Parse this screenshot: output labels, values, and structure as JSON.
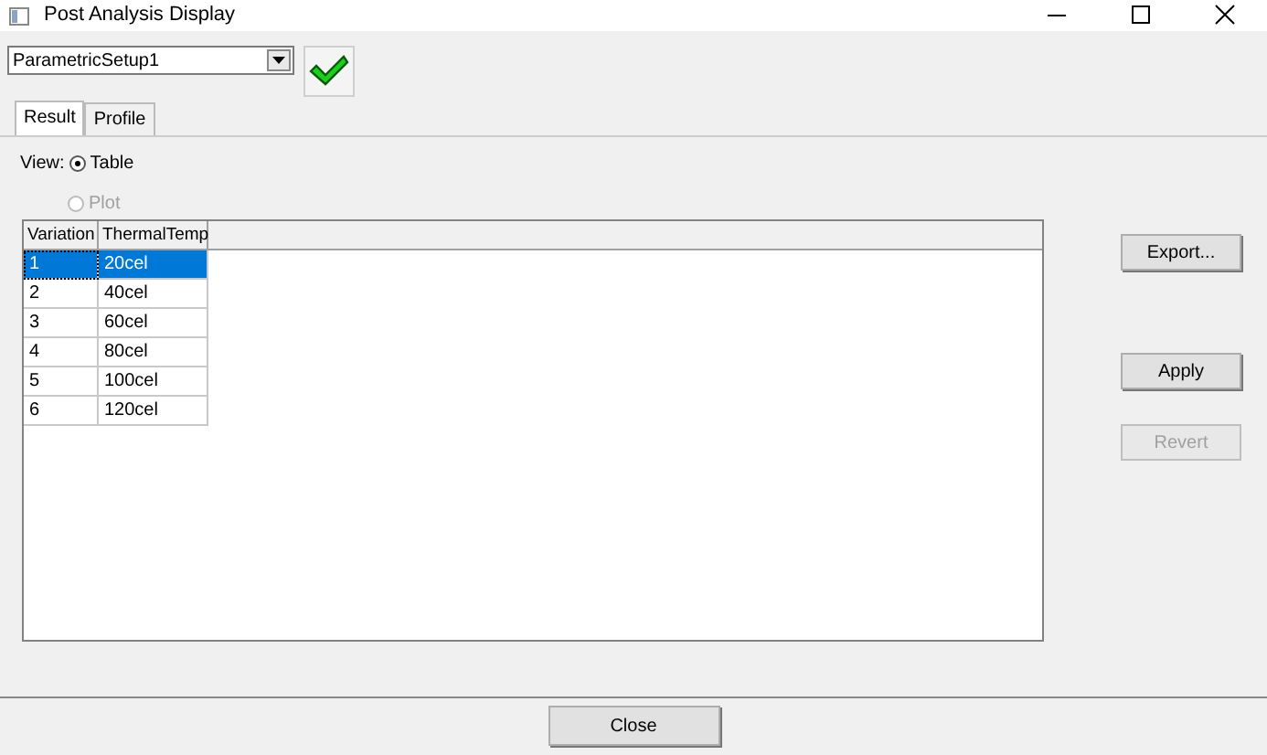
{
  "window": {
    "title": "Post Analysis Display"
  },
  "setup": {
    "value": "ParametricSetup1"
  },
  "tabs": [
    {
      "label": "Result",
      "selected": true
    },
    {
      "label": "Profile",
      "selected": false
    }
  ],
  "view": {
    "label": "View:",
    "options": [
      {
        "label": "Table",
        "selected": true,
        "disabled": false
      },
      {
        "label": "Plot",
        "selected": false,
        "disabled": true
      }
    ]
  },
  "table": {
    "columns": [
      "Variation",
      "ThermalTemp"
    ],
    "rows": [
      {
        "cells": [
          "1",
          "20cel"
        ],
        "selected": true
      },
      {
        "cells": [
          "2",
          "40cel"
        ],
        "selected": false
      },
      {
        "cells": [
          "3",
          "60cel"
        ],
        "selected": false
      },
      {
        "cells": [
          "4",
          "80cel"
        ],
        "selected": false
      },
      {
        "cells": [
          "5",
          "100cel"
        ],
        "selected": false
      },
      {
        "cells": [
          "6",
          "120cel"
        ],
        "selected": false
      }
    ]
  },
  "side_buttons": [
    {
      "label": "Export...",
      "disabled": false
    },
    {
      "label": "Apply",
      "disabled": false
    },
    {
      "label": "Revert",
      "disabled": true
    }
  ],
  "footer_button": {
    "label": "Close"
  }
}
